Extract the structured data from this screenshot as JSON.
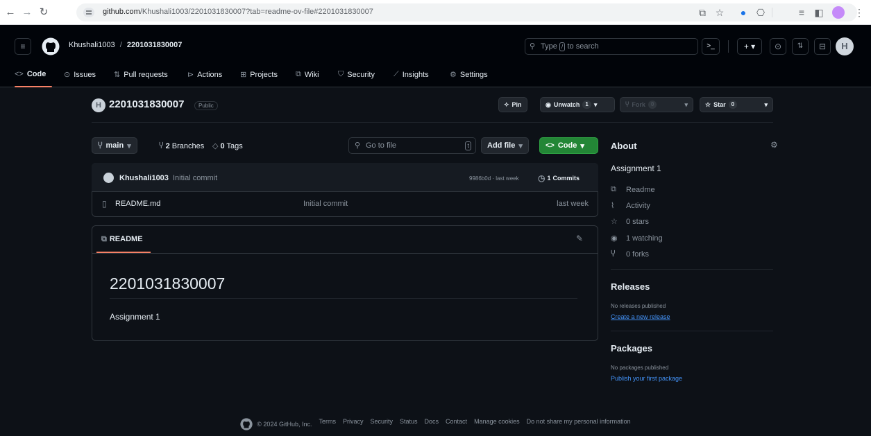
{
  "browser": {
    "url_host": "github.com",
    "url_path": "/Khushali1003/2201031830007?tab=readme-ov-file#2201031830007"
  },
  "header": {
    "owner": "Khushali1003",
    "separator": "/",
    "repo": "2201031830007",
    "search_prefix": "Type",
    "search_key": "/",
    "search_suffix": "to search",
    "avatar_letter": "H"
  },
  "tabs": [
    {
      "label": "Code",
      "icon": "code-icon"
    },
    {
      "label": "Issues",
      "icon": "issue-icon"
    },
    {
      "label": "Pull requests",
      "icon": "pull-request-icon"
    },
    {
      "label": "Actions",
      "icon": "play-icon"
    },
    {
      "label": "Projects",
      "icon": "table-icon"
    },
    {
      "label": "Wiki",
      "icon": "book-icon"
    },
    {
      "label": "Security",
      "icon": "shield-icon"
    },
    {
      "label": "Insights",
      "icon": "graph-icon"
    },
    {
      "label": "Settings",
      "icon": "gear-icon"
    }
  ],
  "repo": {
    "name": "2201031830007",
    "visibility": "Public",
    "pin_label": "Pin",
    "unwatch_label": "Unwatch",
    "watch_count": "1",
    "fork_label": "Fork",
    "fork_count": "0",
    "star_label": "Star",
    "star_count": "0"
  },
  "toolbar": {
    "branch": "main",
    "branches_count": "2",
    "branches_label": "Branches",
    "tags_count": "0",
    "tags_label": "Tags",
    "goto_placeholder": "Go to file",
    "goto_key": "t",
    "add_file_label": "Add file",
    "code_label": "Code"
  },
  "commit": {
    "author": "Khushali1003",
    "message": "Initial commit",
    "hash_time": "9986b0d · last week",
    "commits_count": "1",
    "commits_label": "Commits"
  },
  "files": [
    {
      "name": "README.md",
      "commit": "Initial commit",
      "time": "last week"
    }
  ],
  "readme": {
    "tab_label": "README",
    "heading": "2201031830007",
    "body": "Assignment 1"
  },
  "about": {
    "title": "About",
    "description": "Assignment 1",
    "items": [
      {
        "label": "Readme",
        "icon": "book-icon"
      },
      {
        "label": "Activity",
        "icon": "pulse-icon"
      },
      {
        "label": "0 stars",
        "icon": "star-icon"
      },
      {
        "label": "1 watching",
        "icon": "eye-icon"
      },
      {
        "label": "0 forks",
        "icon": "fork-icon"
      }
    ]
  },
  "releases": {
    "title": "Releases",
    "empty": "No releases published",
    "link": "Create a new release"
  },
  "packages": {
    "title": "Packages",
    "empty": "No packages published",
    "link": "Publish your first package"
  },
  "footer": {
    "copyright": "© 2024 GitHub, Inc.",
    "links": [
      "Terms",
      "Privacy",
      "Security",
      "Status",
      "Docs",
      "Contact",
      "Manage cookies",
      "Do not share my personal information"
    ]
  },
  "colors": {
    "bg": "#0d1117",
    "header_bg": "#010409",
    "accent_green": "#238636",
    "link_blue": "#4493f8",
    "tab_underline": "#f78166"
  }
}
